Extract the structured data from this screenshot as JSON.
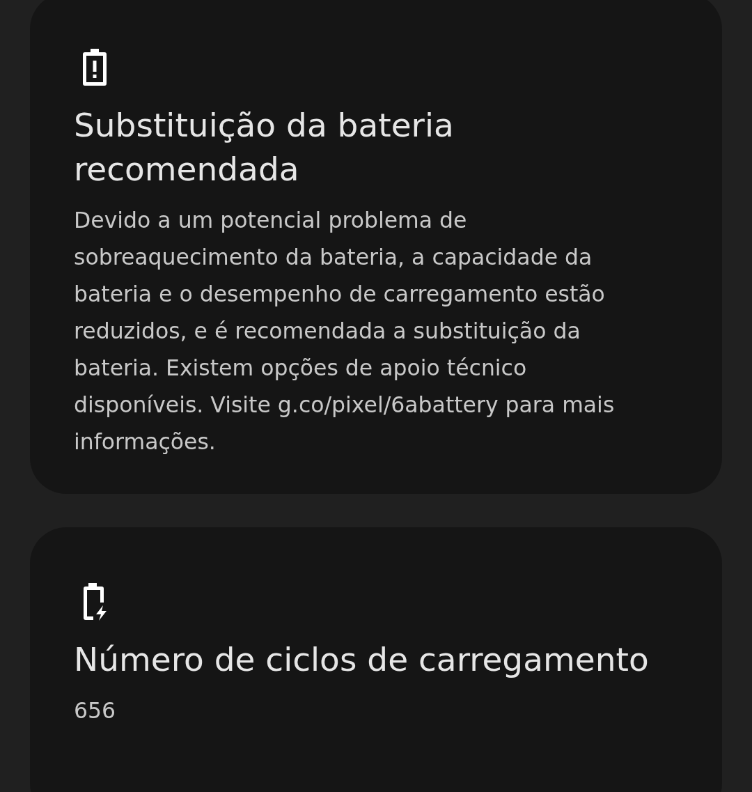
{
  "cards": [
    {
      "kind": "alert",
      "title": "Substituição da bateria recomendada",
      "body": "Devido a um potencial problema de sobreaquecimento da bateria, a capacidade da bateria e o desempenho de carregamento estão reduzidos, e é recomendada a substituição da bateria. Existem opções de apoio técnico disponíveis. Visite g.co/pixel/6abattery para mais informações."
    },
    {
      "kind": "charging",
      "title": "Número de ciclos de carregamento",
      "body": "656"
    }
  ]
}
